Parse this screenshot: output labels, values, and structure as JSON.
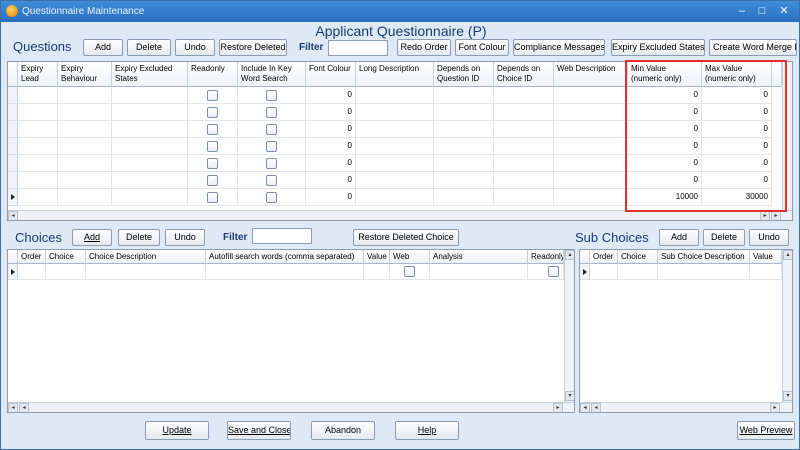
{
  "window": {
    "title": "Questionnaire Maintenance",
    "min": "–",
    "max": "□",
    "close": "✕"
  },
  "page_title": "Applicant Questionnaire (P)",
  "questions": {
    "label": "Questions",
    "buttons": {
      "add": "Add",
      "delete": "Delete",
      "undo": "Undo",
      "restore": "Restore Deleted",
      "redo_order": "Redo Order",
      "font_colour": "Font Colour",
      "compliance": "Compliance Messages",
      "expiry_excluded": "Expiry Excluded States",
      "word_merge": "Create Word Merge Fie"
    },
    "filter_label": "Filter",
    "filter_value": "",
    "columns": [
      "Expiry Lead",
      "Expiry Behaviour",
      "Expiry Excluded States",
      "Readonly",
      "Include In Key Word Search",
      "Font Colour",
      "Long Description",
      "Depends on Question ID",
      "Depends on Choice ID",
      "Web Description",
      "Min Value (numeric only)",
      "Max Value (numeric only)"
    ],
    "rows": [
      {
        "font_colour": "0",
        "min": "0",
        "max": "0"
      },
      {
        "font_colour": "0",
        "min": "0",
        "max": "0"
      },
      {
        "font_colour": "0",
        "min": "0",
        "max": "0"
      },
      {
        "font_colour": "0",
        "min": "0",
        "max": "0"
      },
      {
        "font_colour": "0",
        "min": "0",
        "max": "0"
      },
      {
        "font_colour": "0",
        "min": "0",
        "max": "0"
      },
      {
        "font_colour": "0",
        "min": "10000",
        "max": "30000"
      }
    ]
  },
  "choices": {
    "label": "Choices",
    "buttons": {
      "add": "Add",
      "delete": "Delete",
      "undo": "Undo",
      "restore": "Restore Deleted Choice"
    },
    "filter_label": "Filter",
    "filter_value": "",
    "columns": [
      "Order",
      "Choice ID",
      "Choice Description",
      "Autofill search words (comma separated)",
      "Value",
      "Web Hide",
      "Analysis",
      "Readonly"
    ]
  },
  "sub_choices": {
    "label": "Sub Choices",
    "buttons": {
      "add": "Add",
      "delete": "Delete",
      "undo": "Undo"
    },
    "columns": [
      "Order",
      "Choice ID",
      "Sub Choice Description",
      "Value"
    ]
  },
  "footer": {
    "update": "Update",
    "save_close": "Save and Close",
    "abandon": "Abandon",
    "help": "Help",
    "web_preview": "Web Preview"
  },
  "colors": {
    "title_bar": "#2a6fc2",
    "accent": "#1a3a75",
    "highlight": "#e03030",
    "background": "#dfe9f5"
  }
}
